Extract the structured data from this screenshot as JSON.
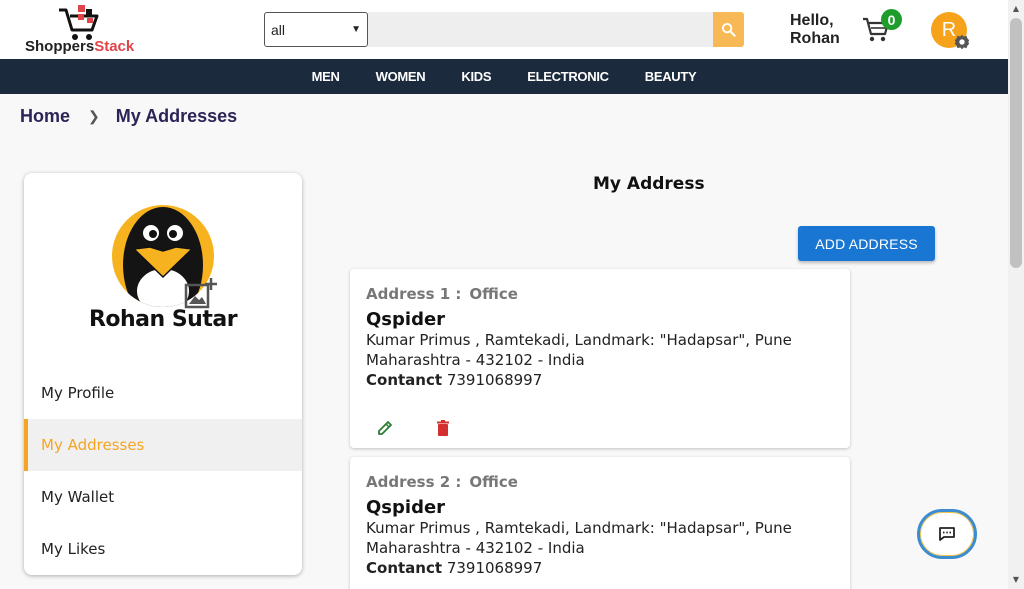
{
  "header": {
    "logo_text_a": "Shoppers",
    "logo_text_b": "Stack",
    "category_select": "all",
    "search_placeholder": "",
    "greeting_line1": "Hello,",
    "greeting_line2": "Rohan",
    "cart_count": "0",
    "avatar_initial": "R"
  },
  "nav": {
    "items": [
      "MEN",
      "WOMEN",
      "KIDS",
      "ELECTRONIC",
      "BEAUTY"
    ]
  },
  "breadcrumb": {
    "home": "Home",
    "current": "My Addresses"
  },
  "sidebar": {
    "user_name": "Rohan Sutar",
    "items": [
      {
        "label": "My Profile"
      },
      {
        "label": "My Addresses"
      },
      {
        "label": "My Wallet"
      },
      {
        "label": "My Likes"
      }
    ]
  },
  "main": {
    "title": "My Address",
    "add_button": "ADD ADDRESS",
    "addresses": [
      {
        "label": "Address 1 :",
        "type": "Office",
        "name": "Qspider",
        "line1": "Kumar Primus , Ramtekadi, Landmark: \"Hadapsar\", Pune",
        "line2": "Maharashtra - 432102 - India",
        "contact_label": "Contanct",
        "contact_value": "7391068997"
      },
      {
        "label": "Address 2 :",
        "type": "Office",
        "name": "Qspider",
        "line1": "Kumar Primus , Ramtekadi, Landmark: \"Hadapsar\", Pune",
        "line2": "Maharashtra - 432102 - India",
        "contact_label": "Contanct",
        "contact_value": "7391068997"
      }
    ]
  },
  "colors": {
    "navbar": "#1b2a3d",
    "accent_orange": "#f5a524",
    "primary_button": "#1976d2",
    "cart_badge": "#1f9d2b",
    "edit_icon": "#2e7d32",
    "delete_icon": "#d32f2f"
  },
  "icons": {
    "logo": "shopping-cart-logo-icon",
    "search": "search-icon",
    "cart": "cart-icon",
    "settings": "gear-icon",
    "avatar_image": "penguin-avatar-icon",
    "add_photo": "add-photo-icon",
    "edit": "pencil-icon",
    "delete": "trash-icon",
    "chat": "chat-icon"
  }
}
